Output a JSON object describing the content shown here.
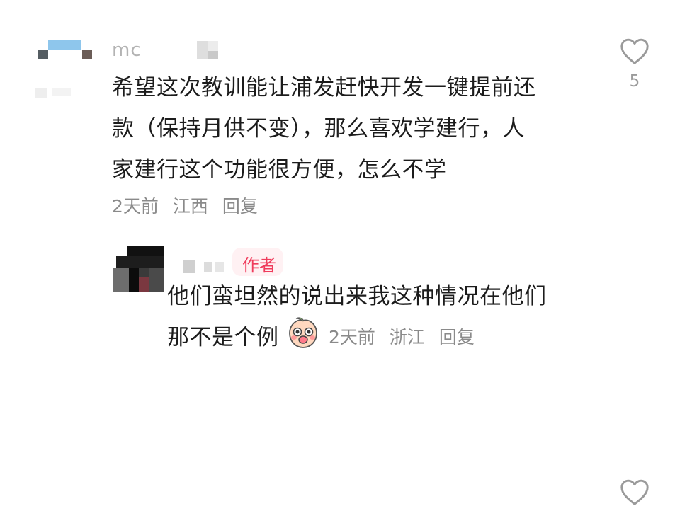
{
  "comments": [
    {
      "username": "mc",
      "text": "希望这次教训能让浦发赶快开发一键提前还\n款（保持月供不变），那么喜欢学建行，人\n家建行这个功能很方便，怎么不学",
      "time": "2天前",
      "location": "江西",
      "reply_label": "回复",
      "like_count": "5",
      "icons": {
        "avatar": "blurred-avatar",
        "like": "heart-outline-icon"
      }
    }
  ],
  "reply": {
    "badge": "作者",
    "text": "他们蛮坦然的说出来我这种情况在他们\n那不是个例",
    "time": "2天前",
    "location": "浙江",
    "reply_label": "回复",
    "icons": {
      "avatar": "blurred-avatar",
      "emoji": "crying-peach-emoji",
      "like": "heart-outline-icon"
    }
  },
  "colors": {
    "text_primary": "#1c1c1c",
    "text_secondary": "#8a8a8a",
    "author_badge_text": "#ef3b5b",
    "author_badge_bg": "#fff1f3",
    "like_icon": "#9a9a9a"
  }
}
